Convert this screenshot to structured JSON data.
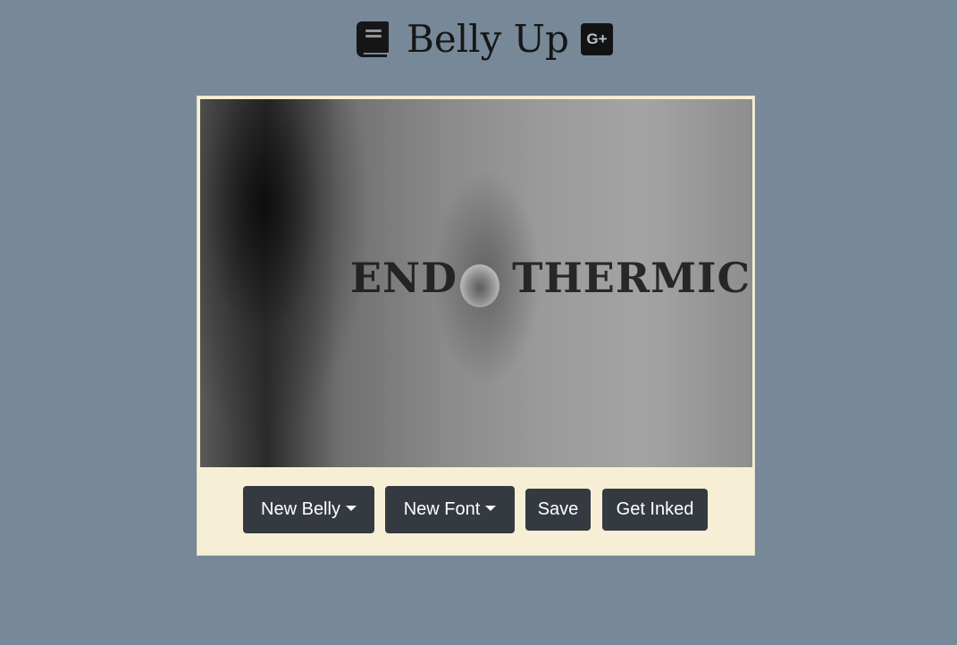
{
  "header": {
    "title": "Belly Up",
    "book_icon": "book-icon",
    "social_icon": "google-plus-icon",
    "social_label": "G+"
  },
  "preview": {
    "tattoo_text": "END      THERMIC"
  },
  "toolbar": {
    "new_belly_label": "New Belly",
    "new_font_label": "New Font",
    "save_label": "Save",
    "get_inked_label": "Get Inked"
  },
  "colors": {
    "page_background": "#778899",
    "card_background": "#f6efd6",
    "button_background": "#343a40",
    "button_text": "#ffffff"
  }
}
